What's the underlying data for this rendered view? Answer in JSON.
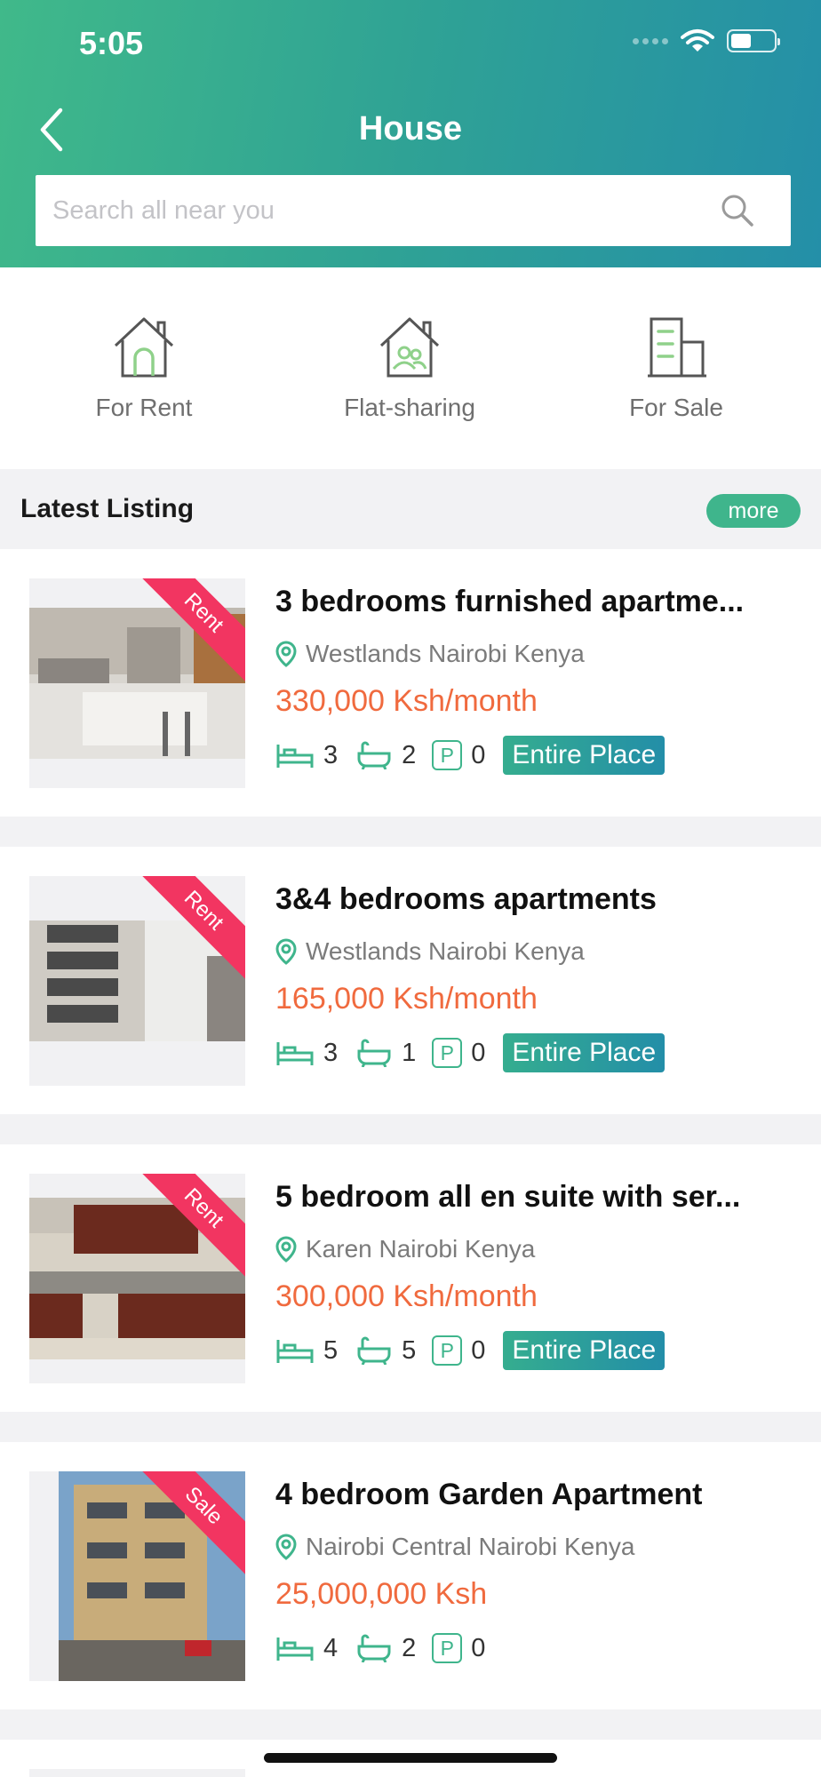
{
  "status_bar": {
    "time": "5:05"
  },
  "header": {
    "title": "House",
    "search_placeholder": "Search all near you"
  },
  "categories": [
    {
      "label": "For Rent",
      "icon": "house-icon"
    },
    {
      "label": "Flat-sharing",
      "icon": "flat-sharing-icon"
    },
    {
      "label": "For Sale",
      "icon": "building-icon"
    }
  ],
  "latest": {
    "title": "Latest Listing",
    "more_label": "more"
  },
  "listings": [
    {
      "ribbon": "Rent",
      "title": "3 bedrooms furnished apartme...",
      "location": "Westlands Nairobi Kenya",
      "price": "330,000 Ksh/month",
      "beds": "3",
      "baths": "2",
      "parking_icon": "P",
      "parking": "0",
      "tag": "Entire Place"
    },
    {
      "ribbon": "Rent",
      "title": "3&4 bedrooms apartments",
      "location": "Westlands Nairobi Kenya",
      "price": "165,000 Ksh/month",
      "beds": "3",
      "baths": "1",
      "parking_icon": "P",
      "parking": "0",
      "tag": "Entire Place"
    },
    {
      "ribbon": "Rent",
      "title": "5 bedroom all en suite with ser...",
      "location": "Karen Nairobi Kenya",
      "price": "300,000 Ksh/month",
      "beds": "5",
      "baths": "5",
      "parking_icon": "P",
      "parking": "0",
      "tag": "Entire Place"
    },
    {
      "ribbon": "Sale",
      "title": "4 bedroom Garden Apartment",
      "location": "Nairobi Central Nairobi Kenya",
      "price": "25,000,000 Ksh",
      "beds": "4",
      "baths": "2",
      "parking_icon": "P",
      "parking": "0",
      "tag": ""
    }
  ],
  "colors": {
    "accent": "#3fb58c",
    "price": "#f06a3e",
    "ribbon": "#f23561"
  }
}
